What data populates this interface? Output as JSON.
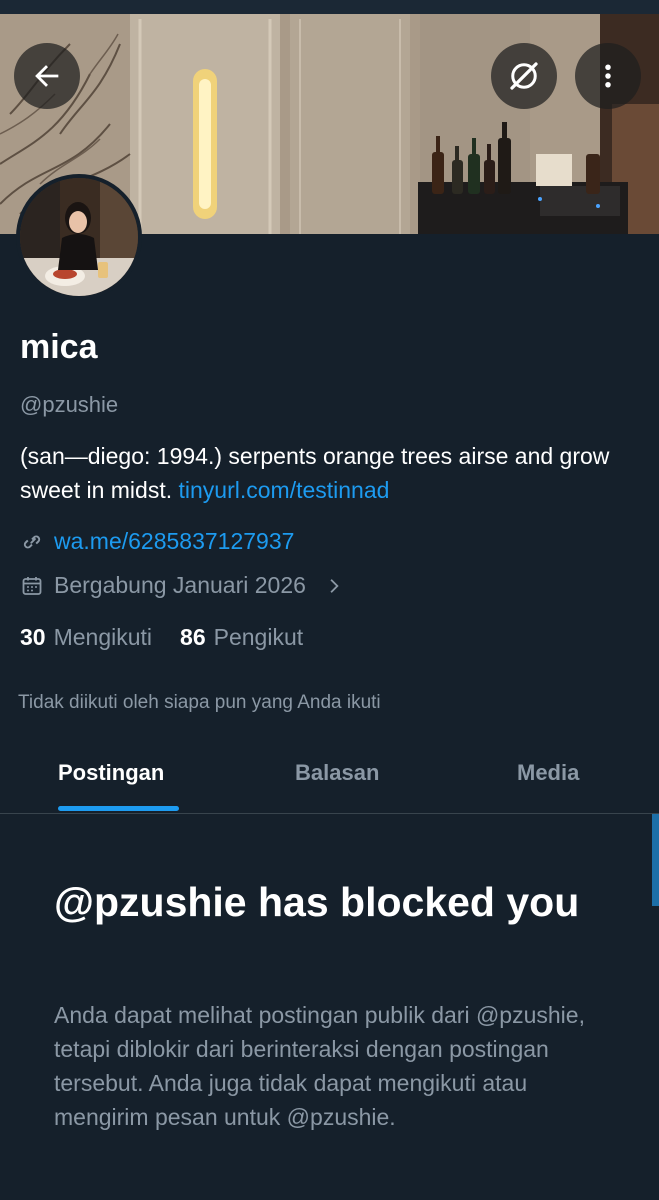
{
  "profile": {
    "display_name": "mica",
    "handle": "@pzushie",
    "bio_text": "(san—diego: 1994.) serpents orange trees airse and grow sweet in midst.",
    "bio_link": "tinyurl.com/testinnad",
    "website": "wa.me/6285837127937",
    "joined": "Bergabung Januari 2026",
    "following_count": "30",
    "following_label": "Mengikuti",
    "followers_count": "86",
    "followers_label": "Pengikut",
    "not_followed_text": "Tidak diikuti oleh siapa pun yang Anda ikuti"
  },
  "header": {
    "back_icon": "arrow-left-icon",
    "grok_icon": "grok-icon",
    "more_icon": "more-vertical-icon"
  },
  "tabs": [
    {
      "label": "Postingan",
      "active": true
    },
    {
      "label": "Balasan",
      "active": false
    },
    {
      "label": "Media",
      "active": false
    }
  ],
  "blocked": {
    "title": "@pzushie has blocked you",
    "description": "Anda dapat melihat postingan publik dari @pzushie, tetapi diblokir dari berinteraksi dengan postingan tersebut. Anda juga tidak dapat mengikuti atau mengirim pesan untuk @pzushie."
  },
  "colors": {
    "background": "#15202b",
    "accent": "#1d9bf0",
    "secondary_text": "#8b98a5",
    "divider": "#38444d"
  }
}
